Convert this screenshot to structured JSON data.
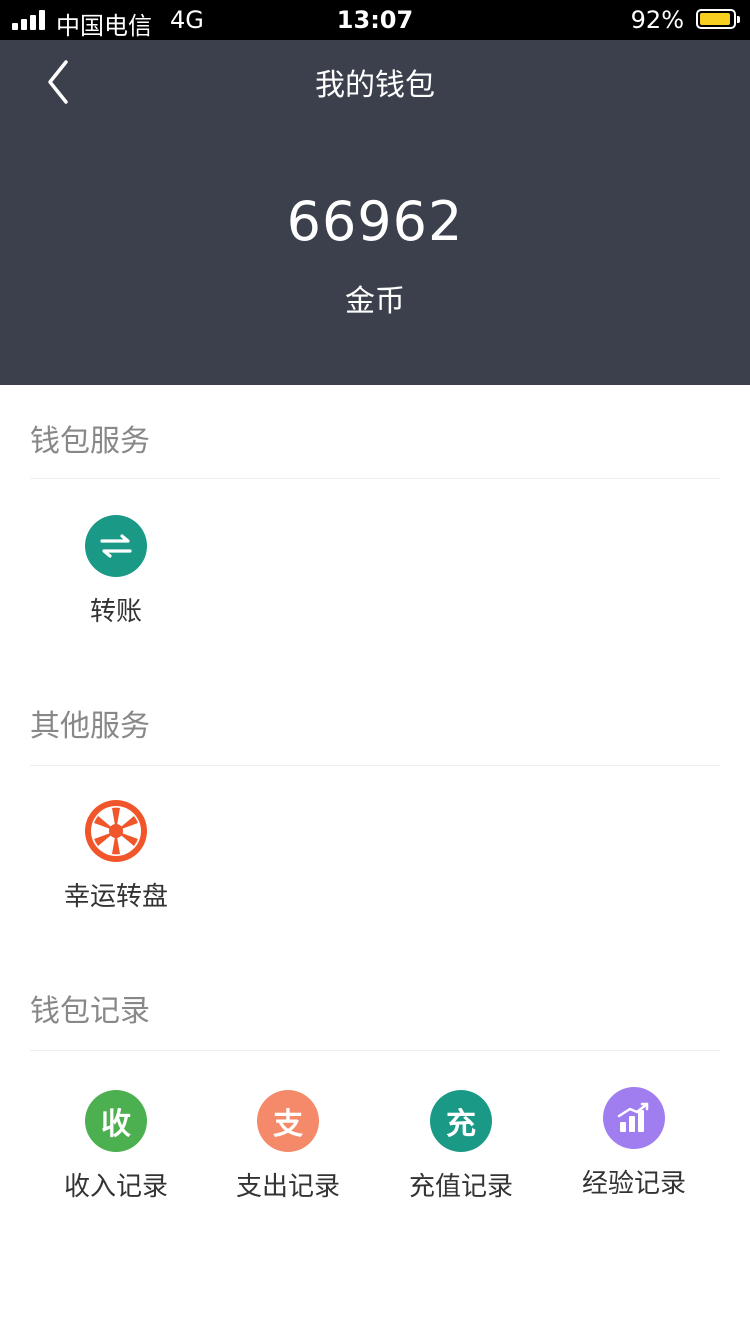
{
  "status_bar": {
    "carrier": "中国电信",
    "network": "4G",
    "time": "13:07",
    "battery": "92%"
  },
  "header": {
    "title": "我的钱包",
    "balance": "66962",
    "balance_label": "金币"
  },
  "sections": {
    "wallet_services": {
      "title": "钱包服务",
      "items": [
        {
          "label": "转账",
          "icon": "transfer-arrows-icon",
          "color": "#1a9a86"
        }
      ]
    },
    "other_services": {
      "title": "其他服务",
      "items": [
        {
          "label": "幸运转盘",
          "icon": "lucky-wheel-icon",
          "color": "#f0562a"
        }
      ]
    },
    "wallet_records": {
      "title": "钱包记录",
      "items": [
        {
          "label": "收入记录",
          "glyph": "收",
          "icon": "income-icon",
          "color": "#4caf50"
        },
        {
          "label": "支出记录",
          "glyph": "支",
          "icon": "expense-icon",
          "color": "#f48a6a"
        },
        {
          "label": "充值记录",
          "glyph": "充",
          "icon": "recharge-icon",
          "color": "#1a9a86"
        },
        {
          "label": "经验记录",
          "icon": "bar-chart-icon",
          "color": "#a07ef0"
        }
      ]
    }
  }
}
